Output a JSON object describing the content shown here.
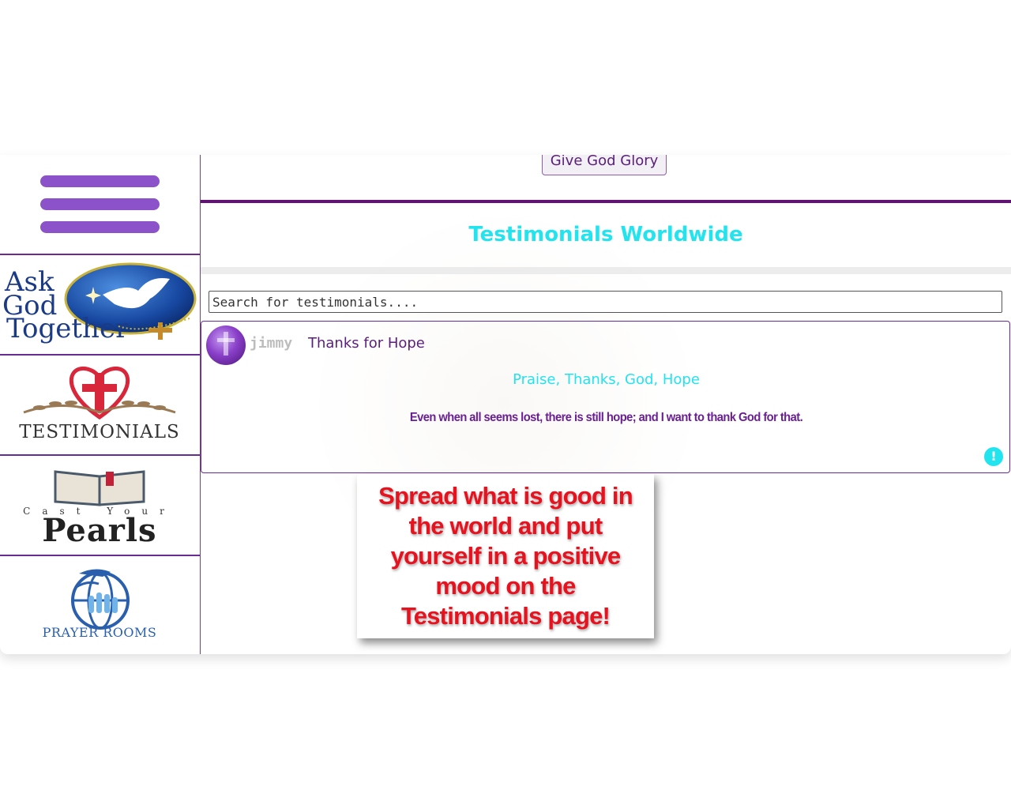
{
  "header": {
    "give_button": "Give God Glory"
  },
  "sidebar": {
    "menu_label": "menu",
    "tiles": [
      {
        "name": "ask-god-together",
        "lines": [
          "Ask",
          "God",
          "Together"
        ]
      },
      {
        "name": "testimonials",
        "text": "TESTIMONIALS"
      },
      {
        "name": "cast-your-pearls",
        "small": "Cast Your",
        "big": "Pearls"
      },
      {
        "name": "prayer-rooms",
        "text": "PRAYER ROOMS"
      }
    ]
  },
  "main": {
    "title": "Testimonials Worldwide",
    "search": {
      "placeholder": "Search for testimonials...."
    },
    "testimonial": {
      "user": "jimmy",
      "title": "Thanks for Hope",
      "tags": "Praise, Thanks, God, Hope",
      "body": "Even when all seems lost, there is still hope; and I want to thank God for that.",
      "report_icon": "!"
    }
  },
  "promo": {
    "text": "Spread what is good in the world and put yourself in a positive mood on the Testimonials page!"
  },
  "colors": {
    "accent": "#22e4ef",
    "purple": "#660e7a",
    "promo_red": "#e8111e"
  }
}
